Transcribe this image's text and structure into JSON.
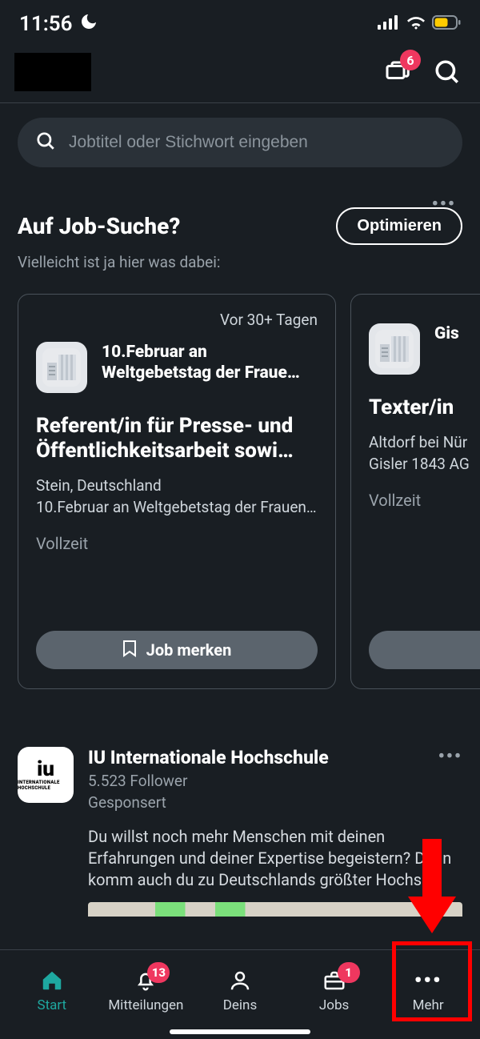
{
  "status": {
    "time": "11:56"
  },
  "header": {
    "chat_badge": "6"
  },
  "search": {
    "placeholder": "Jobtitel oder Stichwort eingeben"
  },
  "job_section": {
    "title": "Auf Job-Suche?",
    "optimize_label": "Optimieren",
    "subtitle": "Vielleicht ist ja hier was dabei:"
  },
  "cards": [
    {
      "age": "Vor 30+ Tagen",
      "company": "10.Februar an Weltgebetstag der Fraue…",
      "role": "Referent/in für Presse- und Öffentlichkeitsarbeit sowi…",
      "location": "Stein, Deutschland",
      "org": "10.Februar an Weltgebetstag der Frauen…",
      "type": "Vollzeit",
      "save_label": "Job merken"
    },
    {
      "age": "",
      "company": "Gis",
      "role": "Texter/in",
      "location": "Altdorf bei Nür",
      "org": "Gisler 1843 AG",
      "type": "Vollzeit",
      "save_label": ""
    }
  ],
  "post": {
    "logo_text": "iu",
    "logo_sub": "INTERNATIONALE HOCHSCHULE",
    "title": "IU Internationale Hochschule",
    "followers": "5.523 Follower",
    "sponsored": "Gesponsert",
    "text": "Du willst noch mehr Menschen mit deinen Erfahrungen und deiner Expertise begeistern? Dann komm auch du zu Deutschlands größter Hochs"
  },
  "nav": {
    "start": "Start",
    "mitteilungen": "Mitteilungen",
    "mitteilungen_badge": "13",
    "deins": "Deins",
    "jobs": "Jobs",
    "jobs_badge": "1",
    "mehr": "Mehr"
  }
}
